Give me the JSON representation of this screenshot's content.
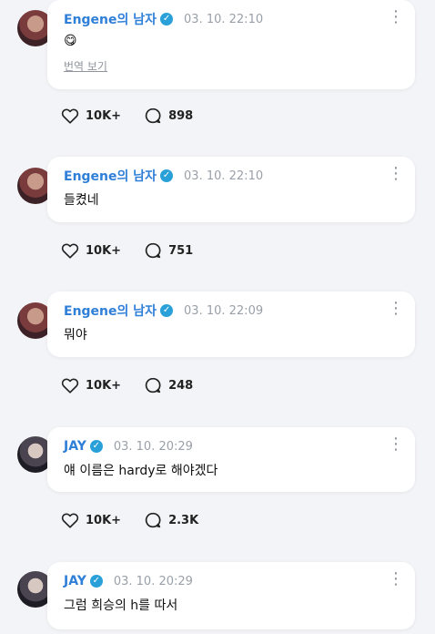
{
  "posts": [
    {
      "author": "Engene의 남자",
      "timestamp": "03. 10. 22:10",
      "message": "😋",
      "translate_label": "번역 보기",
      "likes": "10K+",
      "comments": "898",
      "avatar_style": "red"
    },
    {
      "author": "Engene의 남자",
      "timestamp": "03. 10. 22:10",
      "message": "들켰네",
      "likes": "10K+",
      "comments": "751",
      "avatar_style": "red"
    },
    {
      "author": "Engene의 남자",
      "timestamp": "03. 10. 22:09",
      "message": "뭐야",
      "likes": "10K+",
      "comments": "248",
      "avatar_style": "red"
    },
    {
      "author": "JAY",
      "timestamp": "03. 10. 20:29",
      "message": "얘 이름은 hardy로 해야겠다",
      "likes": "10K+",
      "comments": "2.3K",
      "avatar_style": "dark"
    },
    {
      "author": "JAY",
      "timestamp": "03. 10. 20:29",
      "message": "그럼 희승의 h를 따서",
      "avatar_style": "dark"
    }
  ],
  "icons": {
    "verified": "verified-check-icon",
    "more": "more-vertical-icon",
    "like": "heart-icon",
    "comment": "comment-bubble-icon"
  },
  "colors": {
    "author_name": "#2f7fd8",
    "verified_badge": "#2aa0d8",
    "background": "#f3f4f7"
  }
}
